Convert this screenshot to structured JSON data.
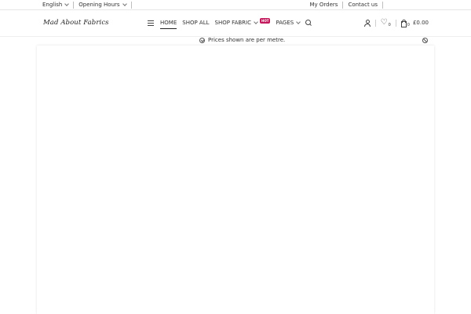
{
  "topbar": {
    "language": "English",
    "opening_hours": "Opening Hours",
    "my_orders": "My Orders",
    "contact_us": "Contact us"
  },
  "header": {
    "logo_text": "Mad About Fabrics",
    "nav": {
      "home": "HOME",
      "shop_all": "SHOP ALL",
      "shop_fabric": "SHOP FABRIC",
      "hot_badge": "HOT",
      "pages": "PAGES"
    },
    "wishlist_count": "0",
    "cart_count": "0",
    "cart_total": "£0.00"
  },
  "notice": {
    "text": "Prices shown are per metre."
  },
  "colors": {
    "hot_badge": "#c2185b"
  }
}
